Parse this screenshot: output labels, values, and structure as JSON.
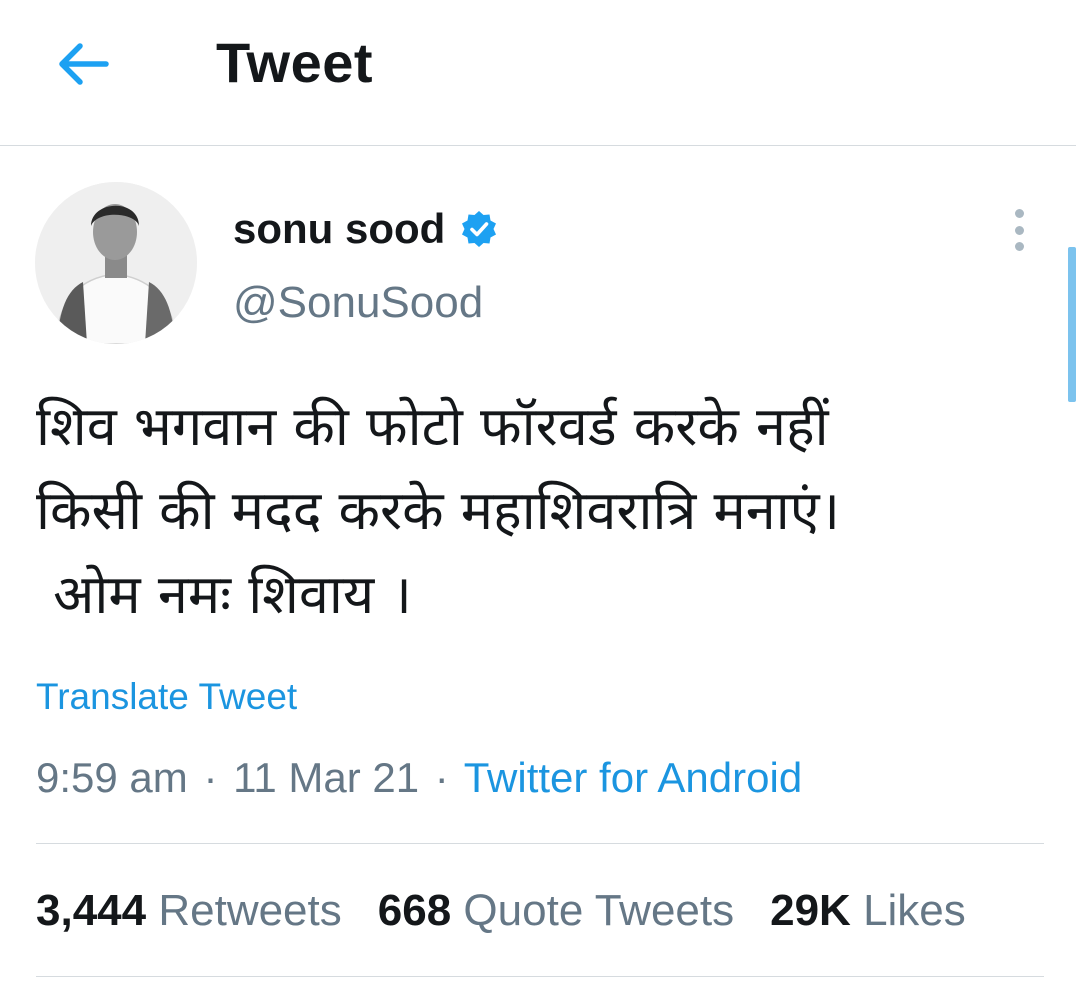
{
  "header": {
    "title": "Tweet",
    "back_icon": "arrow-left-icon",
    "accent_color": "#1da1f2"
  },
  "author": {
    "display_name": "sonu sood",
    "verified": true,
    "verified_icon": "verified-badge-icon",
    "handle": "@SonuSood",
    "avatar_icon": "profile-photo"
  },
  "tweet": {
    "lines": [
      "शिव भगवान की फोटो फॉरवर्ड करके नहीं",
      "किसी की मदद करके महाशिवरात्रि मनाएं।",
      " ओम नमः शिवाय ।"
    ],
    "translate_label": "Translate Tweet",
    "time": "9:59 am",
    "date": "11 Mar 21",
    "separator": "·",
    "source": "Twitter for Android"
  },
  "stats": [
    {
      "count": "3,444",
      "label": "Retweets"
    },
    {
      "count": "668",
      "label": "Quote Tweets"
    },
    {
      "count": "29K",
      "label": "Likes"
    }
  ],
  "menu_icon": "more-vertical-icon"
}
